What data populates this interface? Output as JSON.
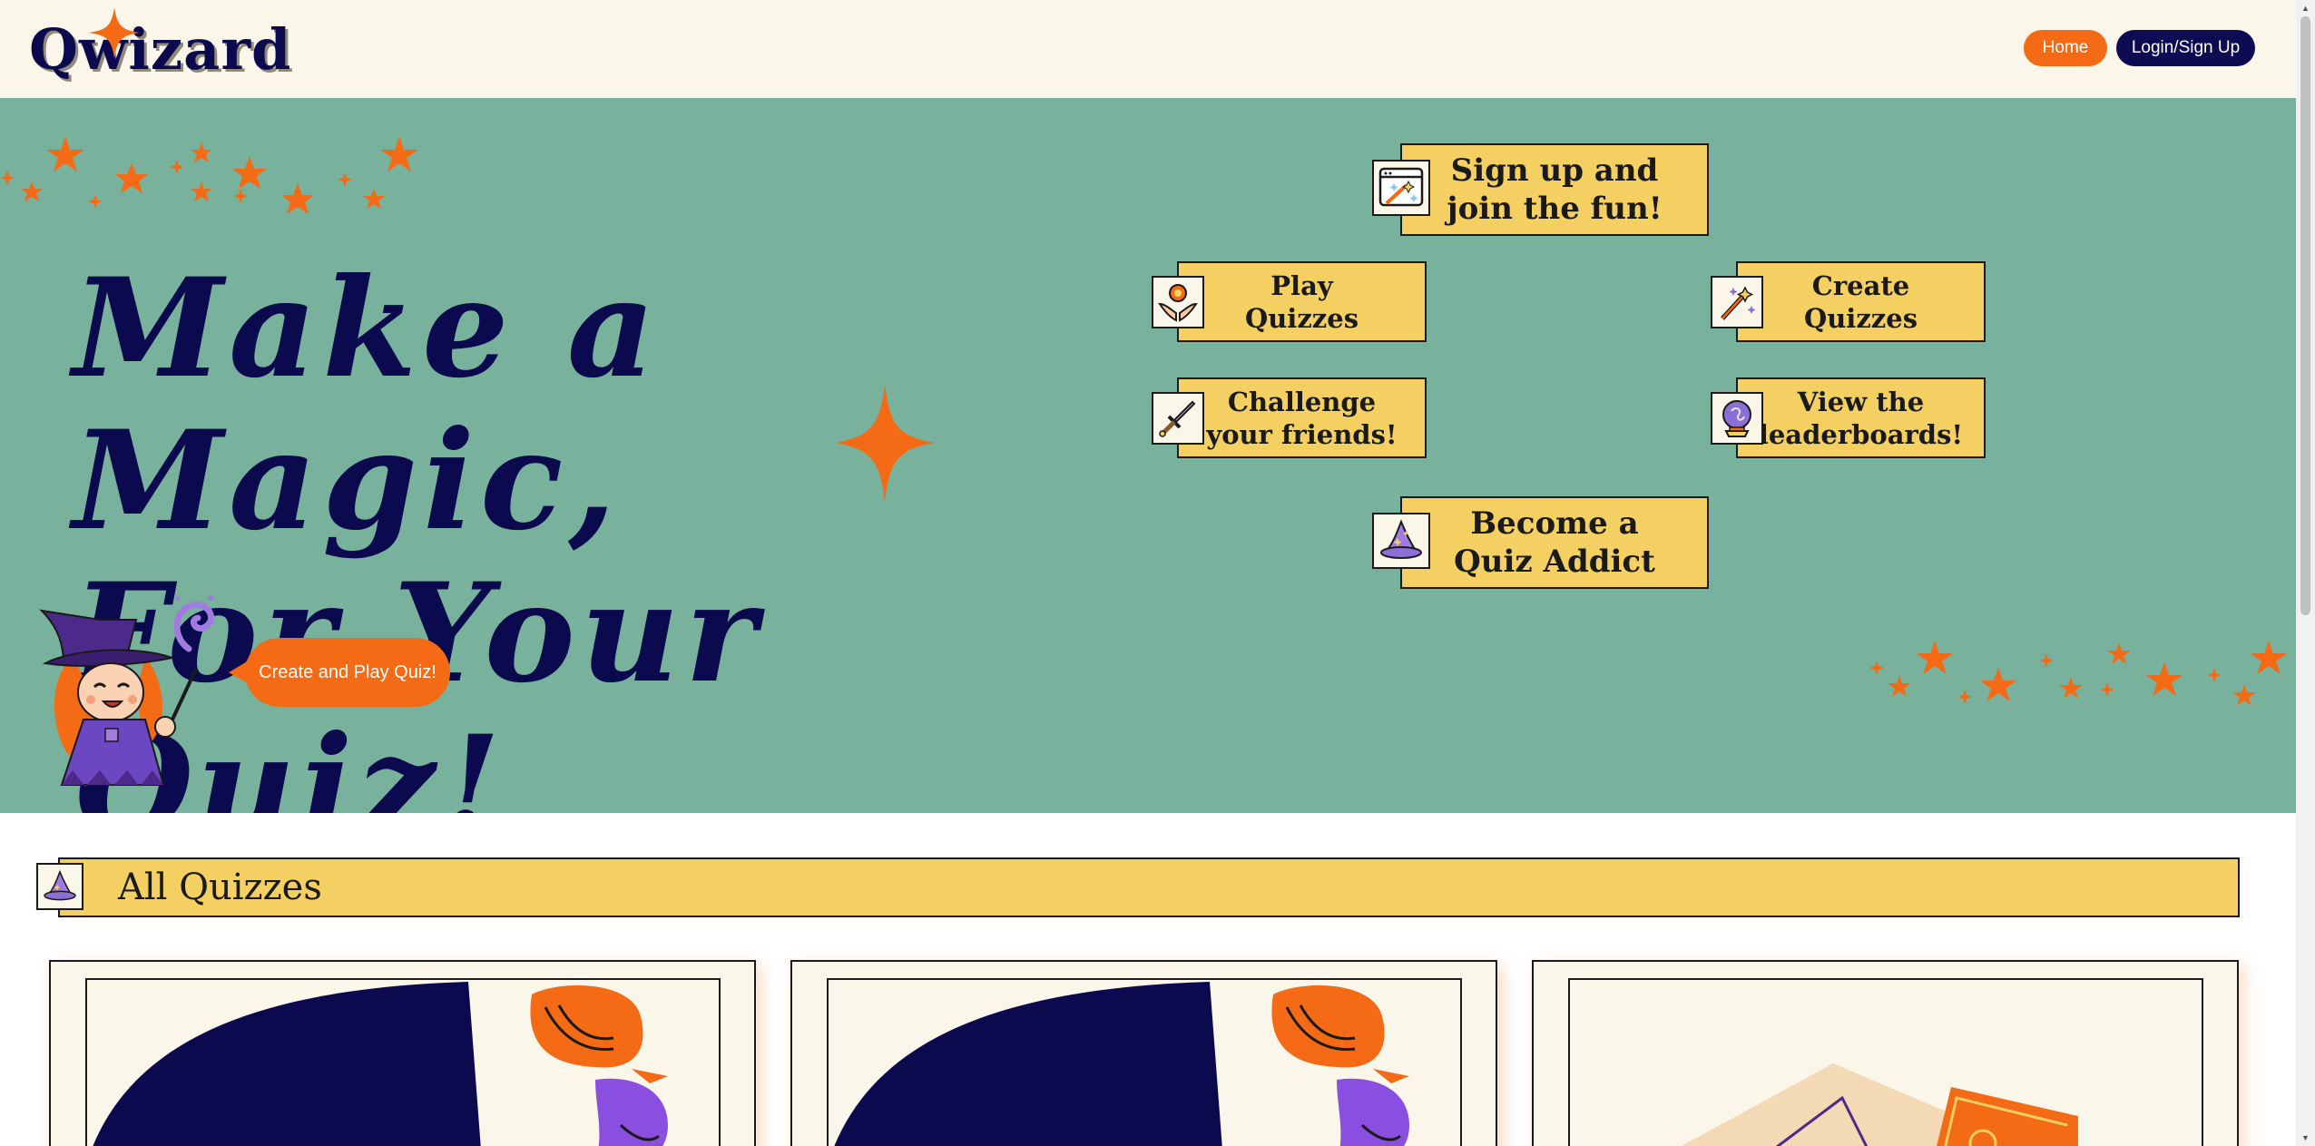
{
  "header": {
    "logo_text": "Qwizard",
    "nav": {
      "home_label": "Home",
      "login_label": "Login/Sign Up"
    }
  },
  "hero": {
    "title_line1": "Make a Magic,",
    "title_line2": "For Your Quiz!",
    "cta_label": "Create and Play Quiz!",
    "features": [
      {
        "label": "Sign up and\njoin the fun!",
        "icon": "magic-screen-icon"
      },
      {
        "label": "Play\nQuizzes",
        "icon": "hands-gem-icon"
      },
      {
        "label": "Create\nQuizzes",
        "icon": "magic-wand-icon"
      },
      {
        "label": "Challenge\nyour friends!",
        "icon": "sword-icon"
      },
      {
        "label": "View the\nleaderboards!",
        "icon": "crystal-ball-icon"
      },
      {
        "label": "Become a\nQuiz Addict",
        "icon": "wizard-hat-icon"
      }
    ]
  },
  "quizzes": {
    "section_title": "All Quizzes",
    "section_icon": "wizard-hat-icon"
  },
  "colors": {
    "hero_bg": "#79b29c",
    "accent_orange": "#f46a15",
    "navy": "#0c0a4e",
    "feature_yellow": "#f4cf62",
    "cream": "#faf6ea"
  }
}
